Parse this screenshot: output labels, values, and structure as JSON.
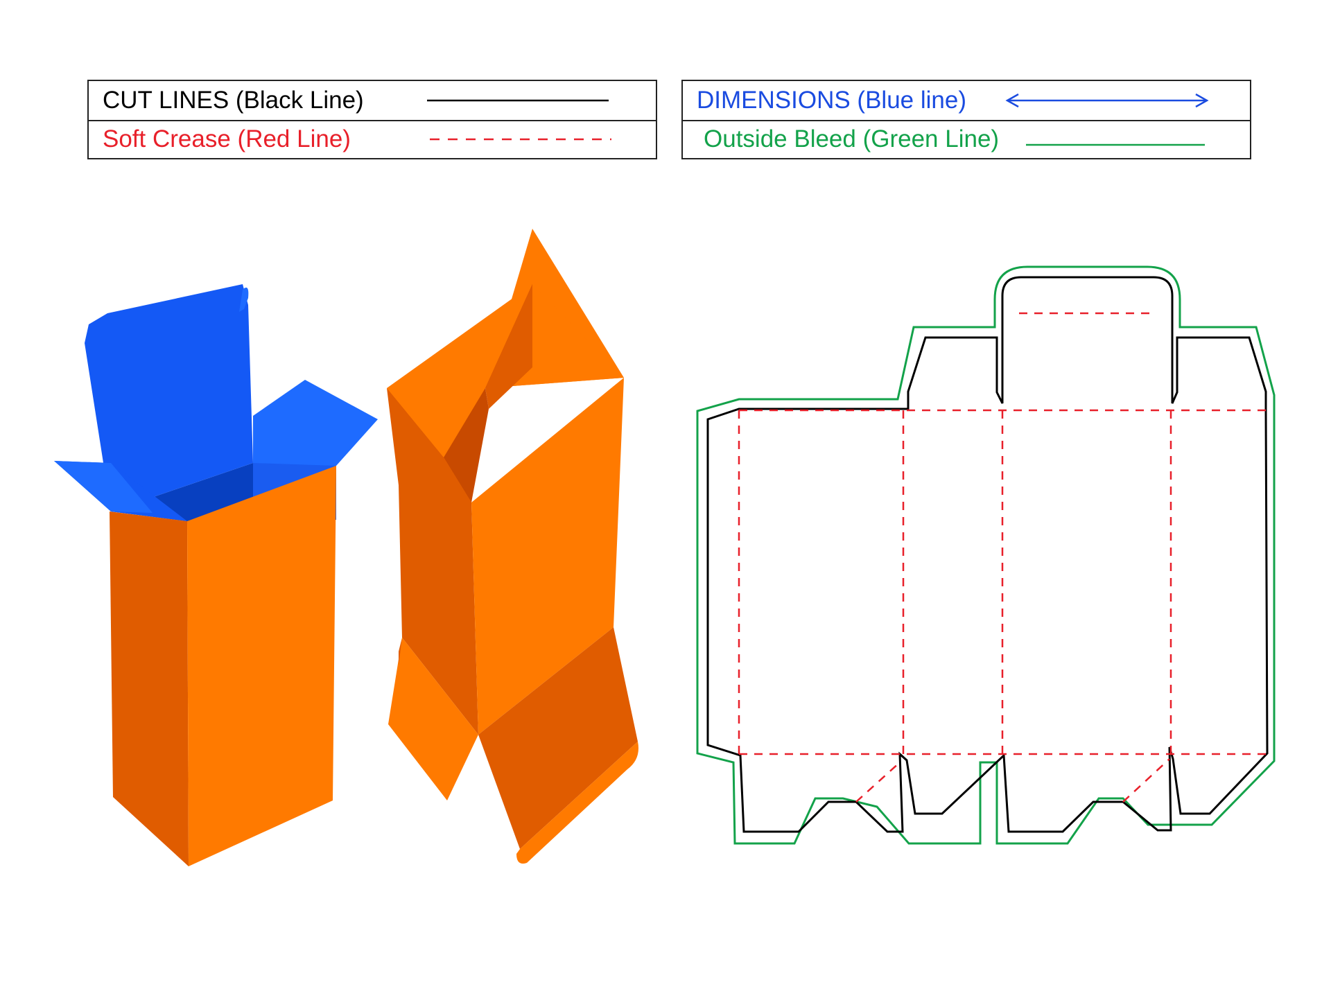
{
  "legend": {
    "cut": {
      "label": "CUT LINES (Black Line)",
      "color": "#000000"
    },
    "crease": {
      "label": "Soft Crease (Red Line)",
      "color": "#e8202a"
    },
    "dimensions": {
      "label": "DIMENSIONS (Blue line)",
      "color": "#1a4be0"
    },
    "bleed": {
      "label": "Outside Bleed (Green Line)",
      "color": "#13a24a"
    }
  },
  "colors": {
    "box_orange_light": "#ff7a00",
    "box_orange_dark": "#e05c00",
    "box_orange_shadow": "#c84a00",
    "box_blue": "#1459f5",
    "box_blue_light": "#1e6bff",
    "box_blue_dark": "#0840c0"
  }
}
